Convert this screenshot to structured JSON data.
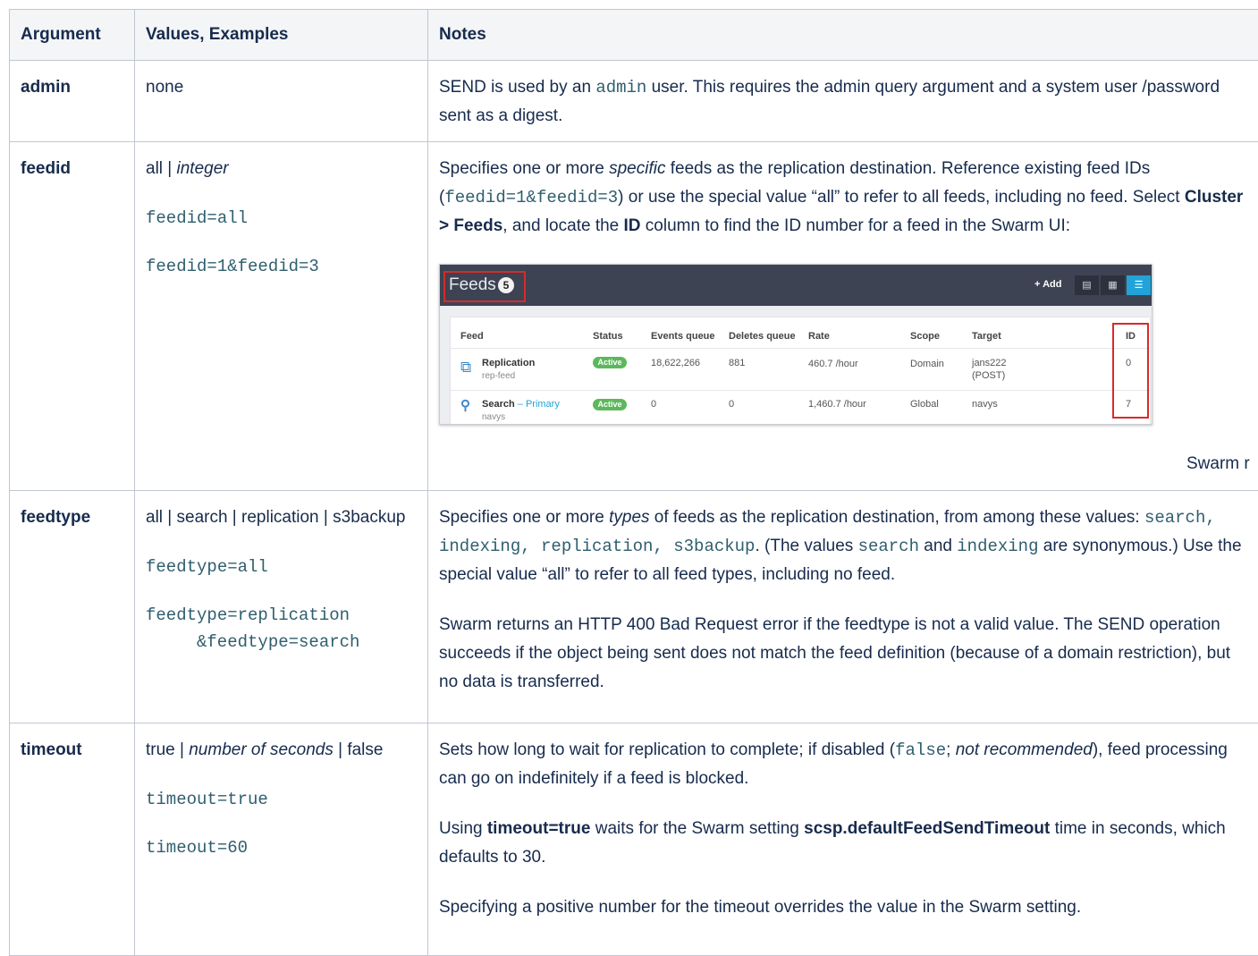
{
  "table": {
    "headers": {
      "argument": "Argument",
      "values": "Values, Examples",
      "notes": "Notes"
    },
    "admin": {
      "arg": "admin",
      "values": "none",
      "notes": {
        "t1": "SEND is used by an ",
        "code1": "admin",
        "t2": " user. This requires the admin query argument and a system user /password sent as a digest."
      }
    },
    "feedid": {
      "arg": "feedid",
      "values_plain": "all | ",
      "values_italic": "integer",
      "ex1": "feedid=all",
      "ex2": "feedid=1&feedid=3",
      "notes": {
        "t1": "Specifies one or more ",
        "i1": "specific",
        "t2": " feeds as the replication destination. Reference existing feed IDs (",
        "code1": "feedid=1&feedid=3",
        "t3": ") or use the special value “all” to refer to all feeds, including no feed. Select ",
        "b1": "Cluster > Feeds",
        "t4": ", and locate the ",
        "b2": "ID",
        "t5": " column to find the ID number for a feed in the Swarm UI:"
      },
      "caption": "Swarm r"
    },
    "feedtype": {
      "arg": "feedtype",
      "values": "all | search | replication | s3backup",
      "ex1": "feedtype=all",
      "ex2a": "feedtype=replication",
      "ex2b": "&feedtype=search",
      "notes1": {
        "t1": "Specifies one or more ",
        "i1": "types",
        "t2": " of feeds as the replication destination, from among these values: ",
        "code1": "search, indexing, replication, s3backup",
        "t3": ". (The values ",
        "code2": "search",
        "t4": " and ",
        "code3": "indexing",
        "t5": " are synonymous.) Use the special value “all” to refer to all feed types, including no feed."
      },
      "notes2": "Swarm returns an HTTP 400 Bad Request error if the feedtype is not a valid value. The SEND operation succeeds if the object being sent does not match the feed definition (because of a domain restriction), but no data is transferred."
    },
    "timeout": {
      "arg": "timeout",
      "v_plain1": "true | ",
      "v_italic": "number of seconds",
      "v_plain2": " | false",
      "ex1": "timeout=true",
      "ex2": "timeout=60",
      "notes1": {
        "t1": "Sets how long to wait for replication to complete; if disabled (",
        "code1": "false",
        "t2": "; ",
        "i1": "not recommended",
        "t3": "), feed processing can go on indefinitely if a feed is blocked."
      },
      "notes2": {
        "t1": "Using ",
        "b1": "timeout=true",
        "t2": " waits for the Swarm setting ",
        "b2": "scsp.defaultFeedSendTimeout",
        "t3": " time in seconds, which defaults to 30."
      },
      "notes3": "Specifying a positive number for the timeout overrides the value in the Swarm setting."
    }
  },
  "feeds_screenshot": {
    "title": "Feeds",
    "count": "5",
    "add_label": "+ Add",
    "columns": [
      "Feed",
      "Status",
      "Events queue",
      "Deletes queue",
      "Rate",
      "Scope",
      "Target",
      "ID"
    ],
    "rows": [
      {
        "name": "Replication",
        "sub": "rep-feed",
        "extra": "",
        "status": "Active",
        "events": "18,622,266",
        "deletes": "881",
        "rate": "460.7 /hour",
        "scope": "Domain",
        "target": "jans222",
        "target_sub": "(POST)",
        "id": "0"
      },
      {
        "name": "Search",
        "sub": "navys",
        "extra": "– Primary",
        "status": "Active",
        "events": "0",
        "deletes": "0",
        "rate": "1,460.7 /hour",
        "scope": "Global",
        "target": "navys",
        "target_sub": "",
        "id": "7"
      }
    ],
    "colors": {
      "header_bg": "#3d4352",
      "highlight": "#d72b2b",
      "active_badge": "#5cb85c",
      "primary_link": "#22a3d8"
    }
  }
}
